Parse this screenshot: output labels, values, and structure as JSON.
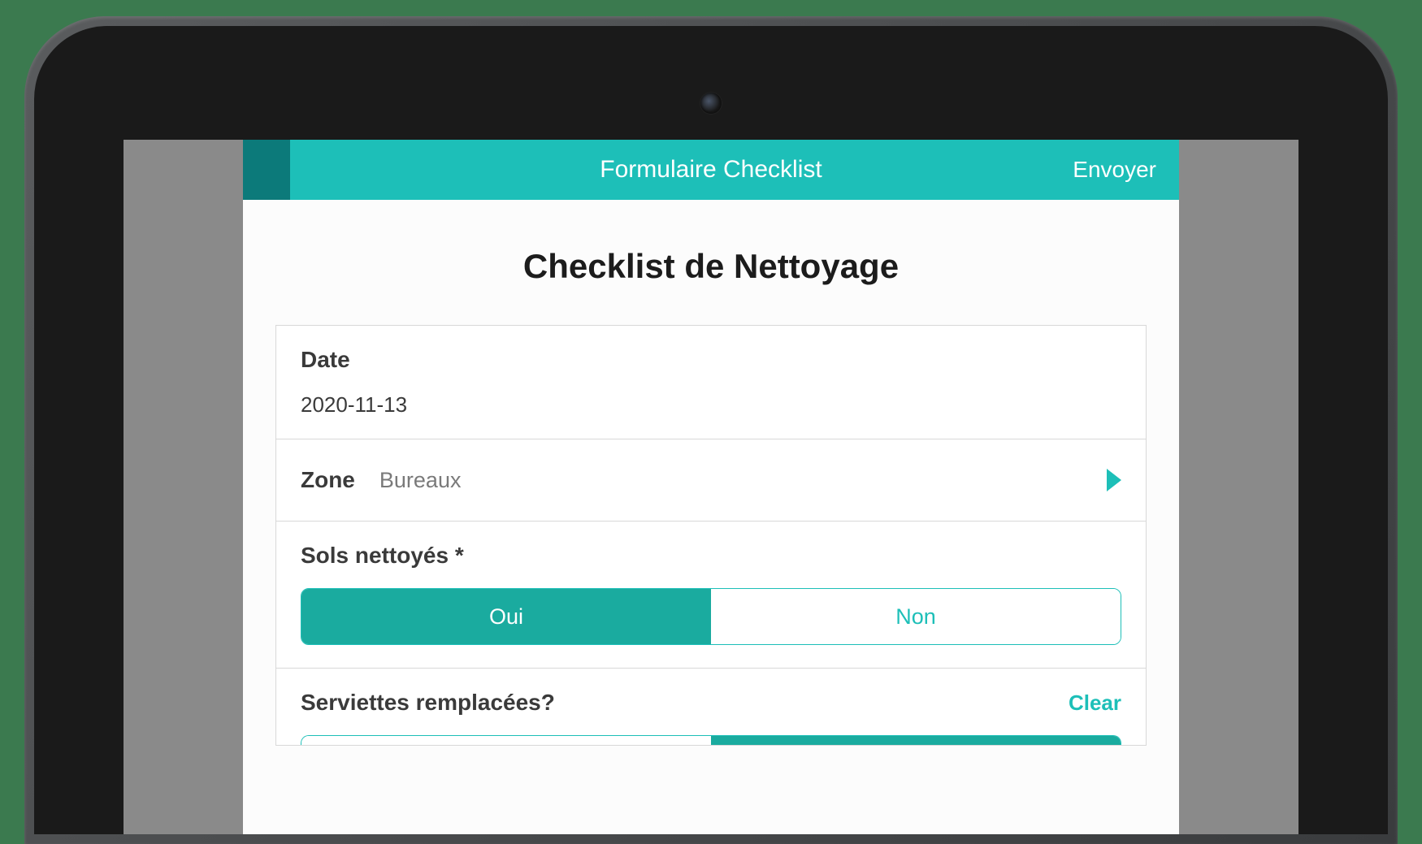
{
  "header": {
    "title": "Formulaire Checklist",
    "submit_label": "Envoyer"
  },
  "page": {
    "title": "Checklist de Nettoyage"
  },
  "form": {
    "date": {
      "label": "Date",
      "value": "2020-11-13"
    },
    "zone": {
      "label": "Zone",
      "value": "Bureaux"
    },
    "floors": {
      "label": "Sols nettoyés *",
      "option_yes": "Oui",
      "option_no": "Non",
      "selected": "Oui"
    },
    "towels": {
      "label": "Serviettes remplacées?",
      "clear_label": "Clear"
    }
  },
  "colors": {
    "accent": "#1dbfb8",
    "accent_dark": "#0c7a7a",
    "toggle_selected": "#1aab9f"
  }
}
